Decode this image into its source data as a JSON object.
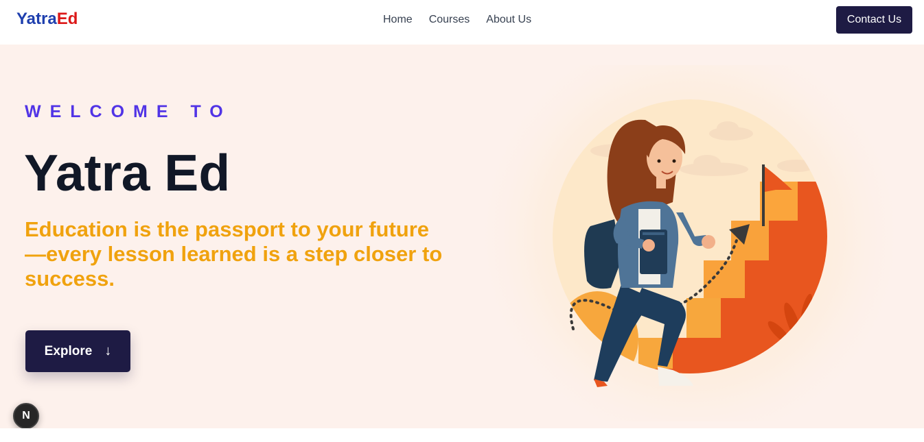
{
  "nav": {
    "logo_part1": "Yatra",
    "logo_part2": "Ed",
    "links": [
      "Home",
      "Courses",
      "About Us"
    ],
    "contact_label": "Contact Us"
  },
  "hero": {
    "eyebrow": "WELCOME TO",
    "title": "Yatra Ed",
    "tagline": "Education is the passport to your future—every lesson learned is a step closer to success.",
    "explore_label": "Explore",
    "explore_arrow": "↓"
  },
  "badge": {
    "letter": "N"
  },
  "colors": {
    "primary_dark": "#1e1b44",
    "logo_blue": "#1e3fae",
    "logo_red": "#dc1818",
    "eyebrow": "#5134e6",
    "tagline": "#f0a20e",
    "hero_bg": "#fdf1ec",
    "stairs": "#e8561f"
  }
}
